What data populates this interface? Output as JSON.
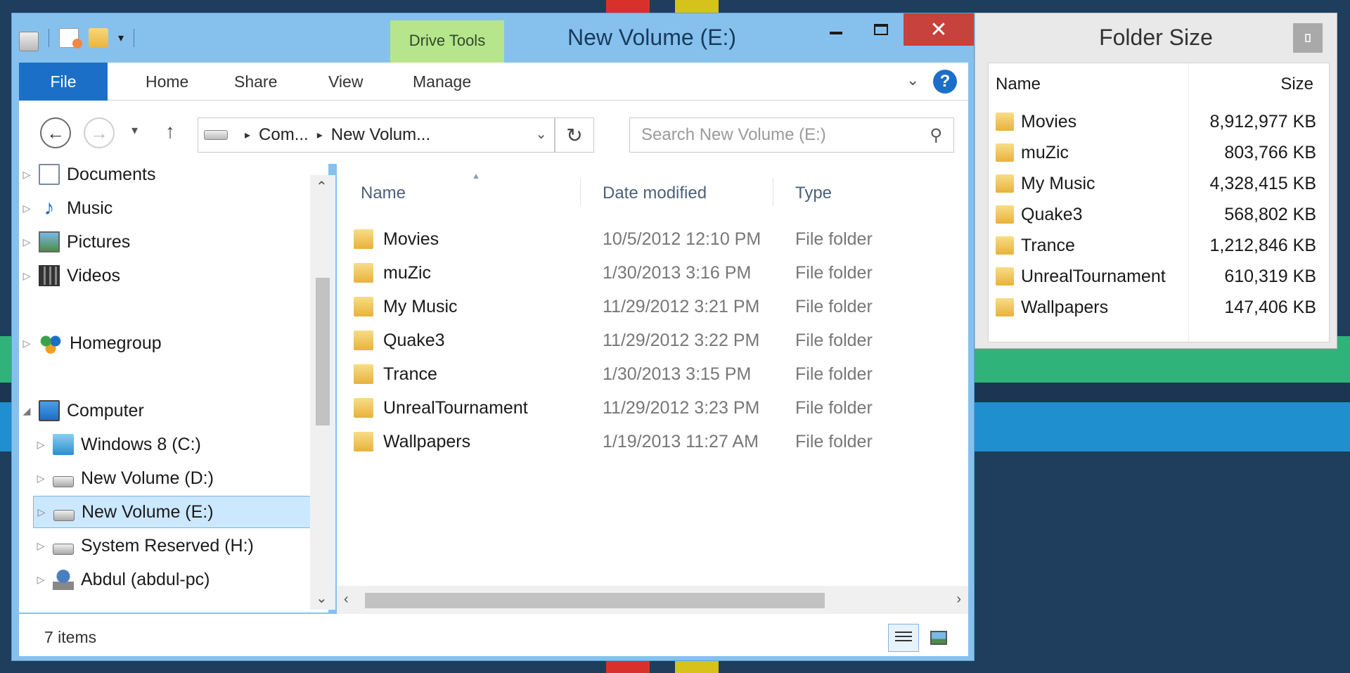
{
  "explorer": {
    "title": "New Volume (E:)",
    "drive_tools_label": "Drive Tools",
    "close_glyph": "✕",
    "ribbon_tabs": [
      "File",
      "Home",
      "Share",
      "View",
      "Manage"
    ],
    "breadcrumb": [
      "Com...",
      "New Volum..."
    ],
    "search_placeholder": "Search New Volume (E:)",
    "nav_tree": [
      {
        "label": "Documents",
        "icon": "documents-icon"
      },
      {
        "label": "Music",
        "icon": "music-icon"
      },
      {
        "label": "Pictures",
        "icon": "pictures-icon"
      },
      {
        "label": "Videos",
        "icon": "videos-icon"
      },
      {
        "label": "Homegroup",
        "icon": "homegroup-icon"
      },
      {
        "label": "Computer",
        "icon": "computer-icon"
      },
      {
        "label": "Windows 8 (C:)",
        "icon": "windows-drive-icon"
      },
      {
        "label": "New Volume (D:)",
        "icon": "drive-icon"
      },
      {
        "label": "New Volume (E:)",
        "icon": "drive-icon",
        "selected": true
      },
      {
        "label": "System Reserved (H:)",
        "icon": "drive-icon"
      },
      {
        "label": "Abdul (abdul-pc)",
        "icon": "network-pc-icon"
      }
    ],
    "columns": {
      "name": "Name",
      "date": "Date modified",
      "type": "Type"
    },
    "files": [
      {
        "name": "Movies",
        "date": "10/5/2012 12:10 PM",
        "type": "File folder"
      },
      {
        "name": "muZic",
        "date": "1/30/2013 3:16 PM",
        "type": "File folder"
      },
      {
        "name": "My Music",
        "date": "11/29/2012 3:21 PM",
        "type": "File folder"
      },
      {
        "name": "Quake3",
        "date": "11/29/2012 3:22 PM",
        "type": "File folder"
      },
      {
        "name": "Trance",
        "date": "1/30/2013 3:15 PM",
        "type": "File folder"
      },
      {
        "name": "UnrealTournament",
        "date": "11/29/2012 3:23 PM",
        "type": "File folder"
      },
      {
        "name": "Wallpapers",
        "date": "1/19/2013 11:27 AM",
        "type": "File folder"
      }
    ],
    "status": "7 items"
  },
  "folder_size": {
    "title": "Folder Size",
    "columns": {
      "name": "Name",
      "size": "Size"
    },
    "rows": [
      {
        "name": "Movies",
        "size": "8,912,977 KB"
      },
      {
        "name": "muZic",
        "size": "803,766 KB"
      },
      {
        "name": "My Music",
        "size": "4,328,415 KB"
      },
      {
        "name": "Quake3",
        "size": "568,802 KB"
      },
      {
        "name": "Trance",
        "size": "1,212,846 KB"
      },
      {
        "name": "UnrealTournament",
        "size": "610,319 KB"
      },
      {
        "name": "Wallpapers",
        "size": "147,406 KB"
      }
    ]
  },
  "colors": {
    "window_frame": "#86c1ee",
    "file_tab": "#1c6fc7",
    "close_button": "#c7413d",
    "drive_tools": "#b7e58c",
    "selection": "#cce8ff"
  }
}
